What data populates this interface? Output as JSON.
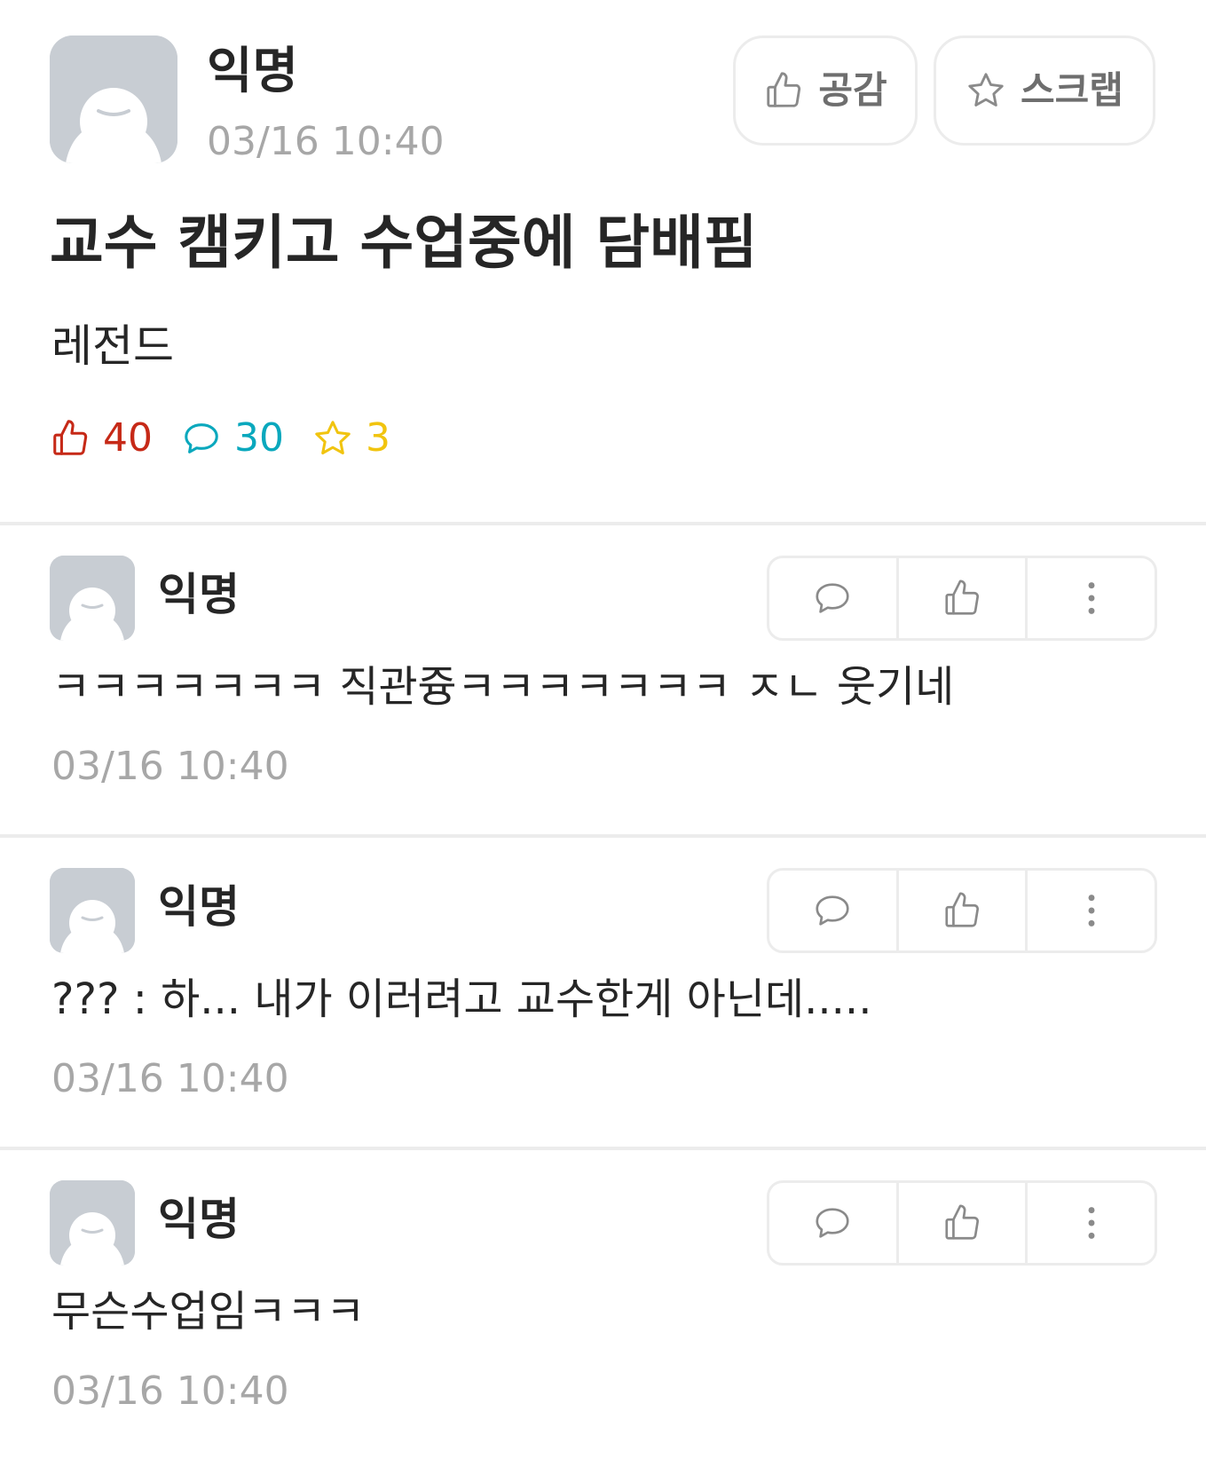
{
  "post": {
    "author": "익명",
    "time": "03/16 10:40",
    "like_button_label": "공감",
    "scrap_button_label": "스크랩",
    "title": "교수 캠키고 수업중에 담배핌",
    "body": "레전드",
    "stats": {
      "likes": "40",
      "comments": "30",
      "scraps": "3"
    }
  },
  "comments": [
    {
      "author": "익명",
      "text": "ㅋㅋㅋㅋㅋㅋㅋ 직관즁ㅋㅋㅋㅋㅋㅋㅋ ㅈㄴ 웃기네",
      "time": "03/16 10:40"
    },
    {
      "author": "익명",
      "text": "??? : 하... 내가 이러려고 교수한게 아닌데.....",
      "time": "03/16 10:40"
    },
    {
      "author": "익명",
      "text": "무슨수업임ㅋㅋㅋ",
      "time": "03/16 10:40"
    }
  ],
  "colors": {
    "like": "#c62917",
    "comment": "#0aa8bd",
    "scrap": "#f1c40f",
    "icon_gray": "#8a8a8a",
    "avatar_bg": "#c8cdd3",
    "divider": "#ececec"
  },
  "icons": {
    "like": "thumbs-up-icon",
    "comment": "speech-bubble-icon",
    "scrap": "star-icon",
    "more": "more-vertical-icon",
    "avatar": "user-avatar-icon"
  }
}
